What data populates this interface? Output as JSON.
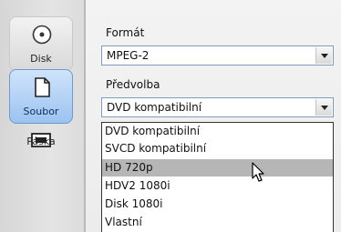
{
  "tabs": [
    {
      "label": "Disk",
      "icon": "disc-icon"
    },
    {
      "label": "Soubor",
      "icon": "file-icon",
      "selected": true
    },
    {
      "label": "Páska",
      "icon": "tape-icon"
    }
  ],
  "format": {
    "label": "Formát",
    "value": "MPEG-2"
  },
  "preset": {
    "label": "Předvolba",
    "value": "DVD kompatibilní",
    "options": [
      "DVD kompatibilní",
      "SVCD kompatibilní",
      "HD 720p",
      "HDV2 1080i",
      "Disk 1080i",
      "Vlastní"
    ],
    "highlighted_option": "HD 720p"
  },
  "colors": {
    "selected_tab": "#9cc3f0",
    "highlight": "#b6b6b6"
  }
}
